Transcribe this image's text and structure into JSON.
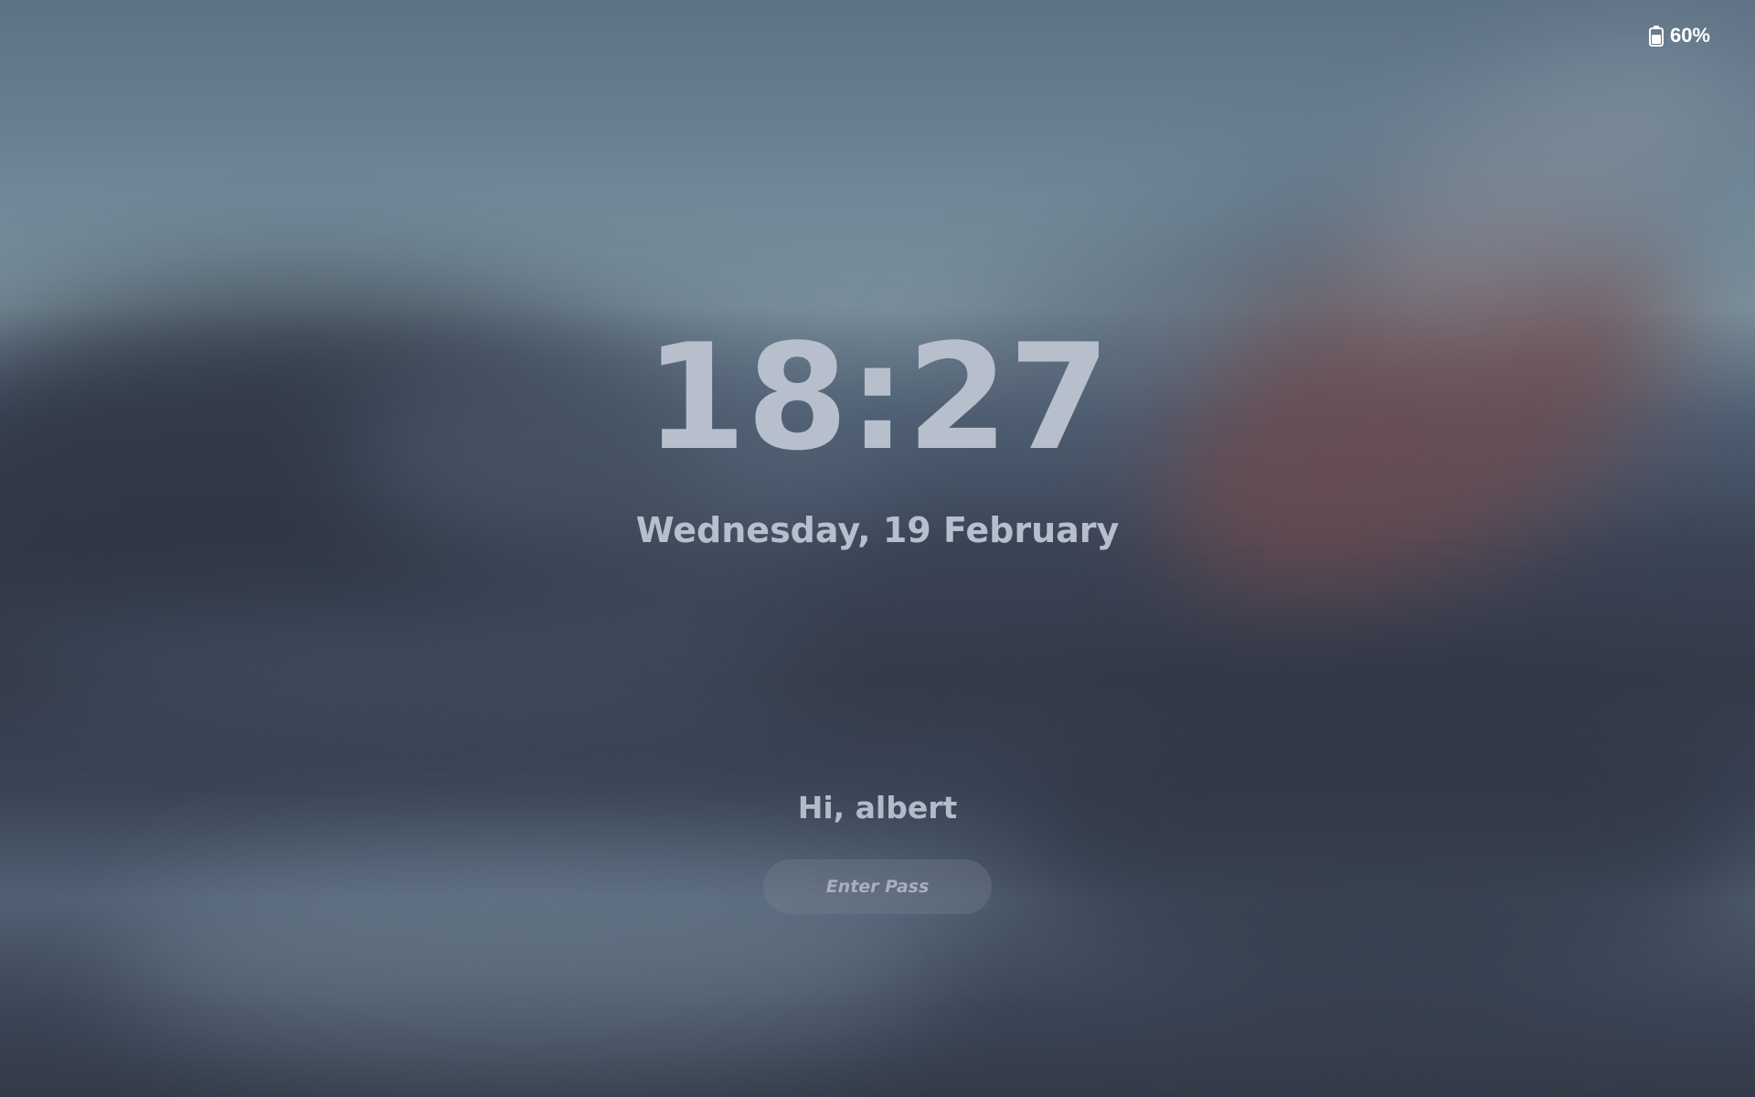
{
  "status_bar": {
    "battery_icon": "battery-icon",
    "battery_percent": "60%"
  },
  "lock_screen": {
    "time": "18:27",
    "date": "Wednesday, 19 February",
    "greeting": "Hi, albert",
    "password_placeholder": "Enter Pass"
  },
  "colors": {
    "text": "#b7bfcc",
    "status_text": "#ffffff",
    "input_background": "rgba(120,130,145,0.35)"
  }
}
